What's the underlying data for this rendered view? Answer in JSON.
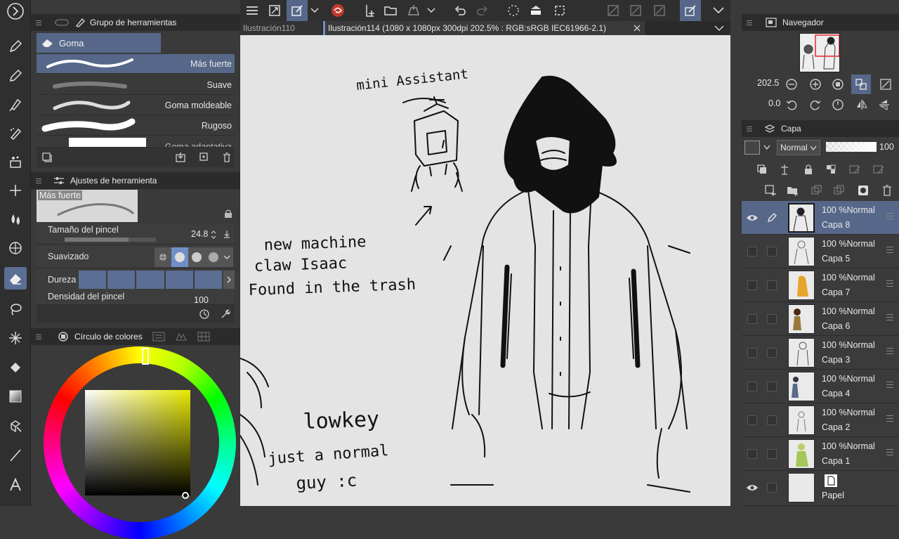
{
  "tool_group_panel": {
    "title": "Grupo de herramientas",
    "active_tool_tab": "Goma",
    "brushes": [
      {
        "name": "Más fuerte",
        "selected": true
      },
      {
        "name": "Suave",
        "selected": false
      },
      {
        "name": "Goma moldeable",
        "selected": false
      },
      {
        "name": "Rugoso",
        "selected": false
      },
      {
        "name": "Goma adaptativa",
        "selected": false
      }
    ]
  },
  "tool_settings_panel": {
    "title": "Ajustes de herramienta",
    "preset_name": "Más fuerte",
    "brush_size_label": "Tamaño del pincel",
    "brush_size_value": "24.8",
    "smoothing_label": "Suavizado",
    "hardness_label": "Dureza",
    "density_label": "Densidad del pincel",
    "density_value": "100"
  },
  "color_panel": {
    "title": "Círculo de colores"
  },
  "tabs": [
    {
      "label": "Ilustración110",
      "active": false
    },
    {
      "label": "Ilustración114 (1080 x 1080px 300dpi 202.5% : RGB:sRGB IEC61966-2.1)",
      "active": true
    }
  ],
  "navigator": {
    "title": "Navegador",
    "zoom": "202.5",
    "rotation": "0.0"
  },
  "layers_panel": {
    "title": "Capa",
    "blend_mode": "Normal",
    "opacity": "100",
    "layers": [
      {
        "mode": "100 %Normal",
        "name": "Capa 8",
        "selected": true,
        "visible": true
      },
      {
        "mode": "100 %Normal",
        "name": "Capa 5",
        "selected": false,
        "visible": false
      },
      {
        "mode": "100 %Normal",
        "name": "Capa 7",
        "selected": false,
        "visible": false
      },
      {
        "mode": "100 %Normal",
        "name": "Capa 6",
        "selected": false,
        "visible": false
      },
      {
        "mode": "100 %Normal",
        "name": "Capa 3",
        "selected": false,
        "visible": false
      },
      {
        "mode": "100 %Normal",
        "name": "Capa 4",
        "selected": false,
        "visible": false
      },
      {
        "mode": "100 %Normal",
        "name": "Capa 2",
        "selected": false,
        "visible": false
      },
      {
        "mode": "100 %Normal",
        "name": "Capa 1",
        "selected": false,
        "visible": false
      }
    ],
    "paper_layer": {
      "name": "Papel"
    }
  },
  "canvas_notes": {
    "note1": "mini Assistant",
    "note2_line1": "new machine",
    "note2_line2": "claw Isaac",
    "note2_line3": "Found in the trash",
    "note3_line1": "lowkey",
    "note3_line2": "just a normal",
    "note3_line3": "guy :c"
  },
  "colors": {
    "accent": "#566789",
    "panel_bg": "#3a3a3a",
    "header_bg": "#2b2b2b",
    "canvas_bg": "#e4e4e4"
  }
}
